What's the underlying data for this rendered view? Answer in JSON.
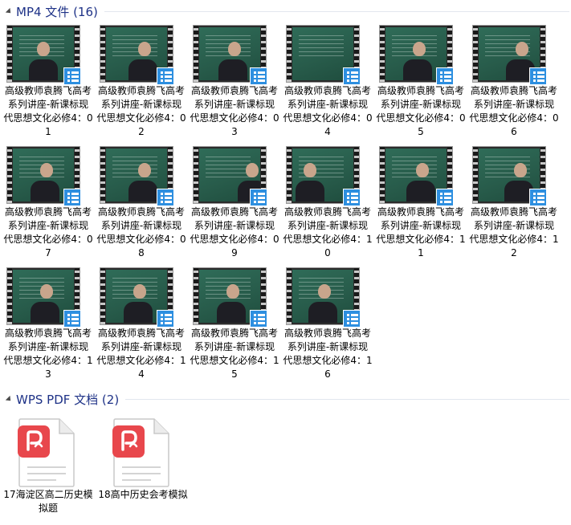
{
  "groups": [
    {
      "title": "MP4 文件 (16)"
    },
    {
      "title": "WPS PDF 文档 (2)"
    }
  ],
  "videos": [
    {
      "label": "高级教师袁腾飞高考系列讲座-新课标现代思想文化必修4：01"
    },
    {
      "label": "高级教师袁腾飞高考系列讲座-新课标现代思想文化必修4：02"
    },
    {
      "label": "高级教师袁腾飞高考系列讲座-新课标现代思想文化必修4：03"
    },
    {
      "label": "高级教师袁腾飞高考系列讲座-新课标现代思想文化必修4：04"
    },
    {
      "label": "高级教师袁腾飞高考系列讲座-新课标现代思想文化必修4：05"
    },
    {
      "label": "高级教师袁腾飞高考系列讲座-新课标现代思想文化必修4：06"
    },
    {
      "label": "高级教师袁腾飞高考系列讲座-新课标现代思想文化必修4：07"
    },
    {
      "label": "高级教师袁腾飞高考系列讲座-新课标现代思想文化必修4：08"
    },
    {
      "label": "高级教师袁腾飞高考系列讲座-新课标现代思想文化必修4：09"
    },
    {
      "label": "高级教师袁腾飞高考系列讲座-新课标现代思想文化必修4：10"
    },
    {
      "label": "高级教师袁腾飞高考系列讲座-新课标现代思想文化必修4：11"
    },
    {
      "label": "高级教师袁腾飞高考系列讲座-新课标现代思想文化必修4：12"
    },
    {
      "label": "高级教师袁腾飞高考系列讲座-新课标现代思想文化必修4：13"
    },
    {
      "label": "高级教师袁腾飞高考系列讲座-新课标现代思想文化必修4：14"
    },
    {
      "label": "高级教师袁腾飞高考系列讲座-新课标现代思想文化必修4：15"
    },
    {
      "label": "高级教师袁腾飞高考系列讲座-新课标现代思想文化必修4：16"
    }
  ],
  "pdfs": [
    {
      "label": "17海淀区高二历史模拟题"
    },
    {
      "label": "18高中历史会考模拟"
    }
  ],
  "colors": {
    "group_title": "#1e3287",
    "video_badge": "#2d8fe0",
    "pdf_badge": "#e8474c"
  },
  "icons": {
    "video_thumb": "video-thumbnail-icon",
    "video_badge": "video-file-badge-icon",
    "pdf": "wps-pdf-file-icon",
    "collapse": "chevron-collapse-icon"
  }
}
